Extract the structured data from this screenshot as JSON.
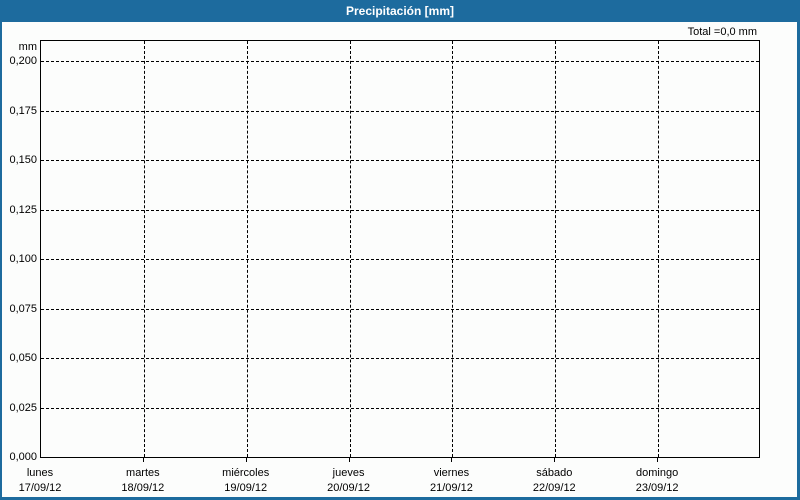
{
  "window": {
    "title": "Precipitación [mm]"
  },
  "summary": {
    "total_label": "Total =0,0 mm"
  },
  "y_axis": {
    "unit": "mm",
    "ticks": [
      "0,200",
      "0,175",
      "0,150",
      "0,125",
      "0,100",
      "0,075",
      "0,050",
      "0,025",
      "0,000"
    ]
  },
  "x_axis": {
    "days": [
      {
        "name": "lunes",
        "date": "17/09/12"
      },
      {
        "name": "martes",
        "date": "18/09/12"
      },
      {
        "name": "miércoles",
        "date": "19/09/12"
      },
      {
        "name": "jueves",
        "date": "20/09/12"
      },
      {
        "name": "viernes",
        "date": "21/09/12"
      },
      {
        "name": "sábado",
        "date": "22/09/12"
      },
      {
        "name": "domingo",
        "date": "23/09/12"
      }
    ]
  },
  "colors": {
    "accent_blue": "#1d6b9e",
    "grid": "#000000",
    "background": "#fcfdfc",
    "title_text": "#ffffff"
  },
  "chart_data": {
    "type": "bar",
    "title": "Precipitación [mm]",
    "categories": [
      "lunes 17/09/12",
      "martes 18/09/12",
      "miércoles 19/09/12",
      "jueves 20/09/12",
      "viernes 21/09/12",
      "sábado 22/09/12",
      "domingo 23/09/12"
    ],
    "values": [
      0,
      0,
      0,
      0,
      0,
      0,
      0
    ],
    "total_label": "Total =0,0 mm",
    "xlabel": "",
    "ylabel": "mm",
    "ylim": [
      0,
      0.21
    ],
    "y_ticks": [
      0.0,
      0.025,
      0.05,
      0.075,
      0.1,
      0.125,
      0.15,
      0.175,
      0.2
    ],
    "y_tick_format": "decimal-comma, 3 places",
    "grid": "dashed black, horizontal at each y tick and vertical at each day boundary",
    "legend_position": "none"
  }
}
